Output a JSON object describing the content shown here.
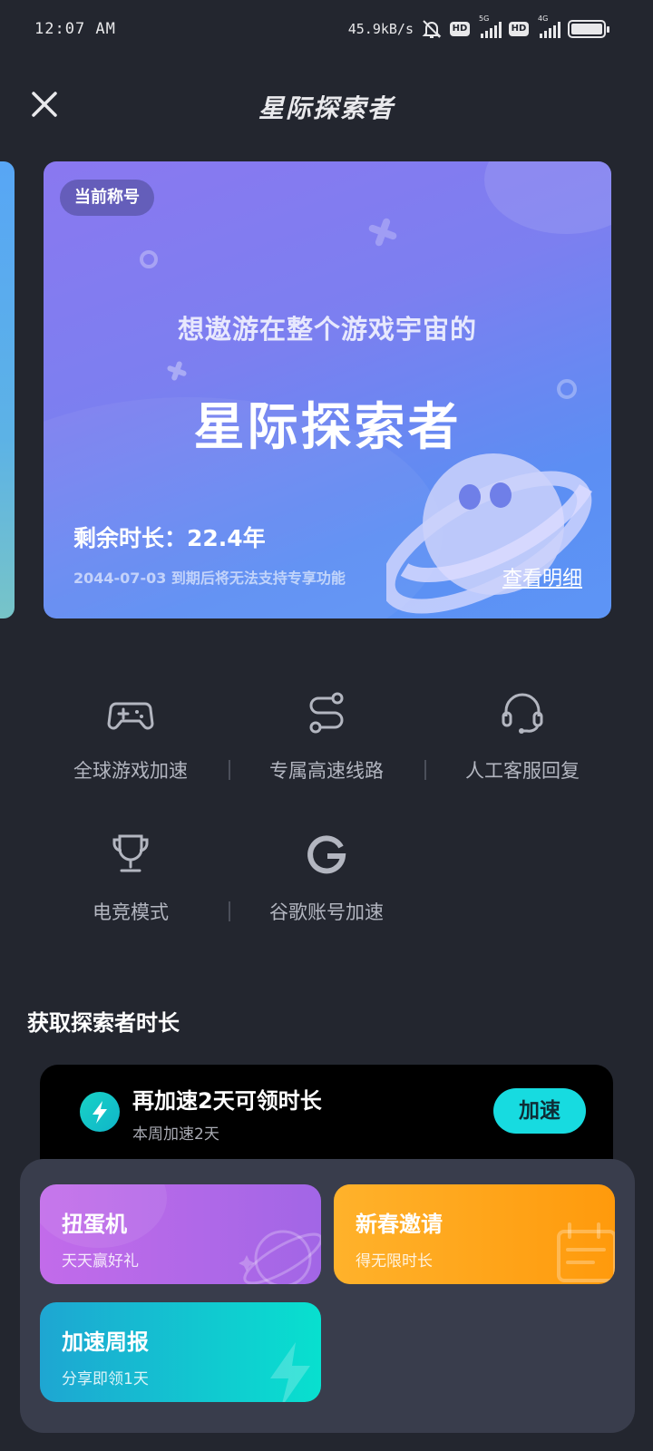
{
  "status_bar": {
    "time": "12:07 AM",
    "net_speed": "45.9kB/s",
    "sim1_tag": "HD",
    "sim1_gen": "5G",
    "sim2_tag": "HD",
    "sim2_gen": "4G",
    "battery_level": 1.0
  },
  "header": {
    "title": "星际探索者",
    "close_icon": "close-icon"
  },
  "hero": {
    "badge": "当前称号",
    "subtitle": "想遨游在整个游戏宇宙的",
    "title": "星际探索者",
    "remaining": "剩余时长：22.4年",
    "expire_note": "2044-07-03 到期后将无法支持专享功能",
    "detail_link": "查看明细",
    "colors": {
      "start": "#8a78f0",
      "end": "#5d95f6"
    }
  },
  "features": [
    {
      "label": "全球游戏加速",
      "icon": "gamepad-icon"
    },
    {
      "label": "专属高速线路",
      "icon": "route-icon"
    },
    {
      "label": "人工客服回复",
      "icon": "headset-icon"
    },
    {
      "label": "电竞模式",
      "icon": "trophy-icon"
    },
    {
      "label": "谷歌账号加速",
      "icon": "google-icon"
    }
  ],
  "section": {
    "title": "获取探索者时长"
  },
  "task": {
    "title": "再加速2天可领时长",
    "subtitle": "本周加速2天",
    "button": "加速",
    "accent": "#17dbe0"
  },
  "tiles": [
    {
      "title": "扭蛋机",
      "subtitle": "天天赢好礼",
      "color": "#b469e8"
    },
    {
      "title": "新春邀请",
      "subtitle": "得无限时长",
      "color": "#ffa51a"
    },
    {
      "title": "加速周报",
      "subtitle": "分享即领1天",
      "color": "#12c3d0"
    }
  ]
}
